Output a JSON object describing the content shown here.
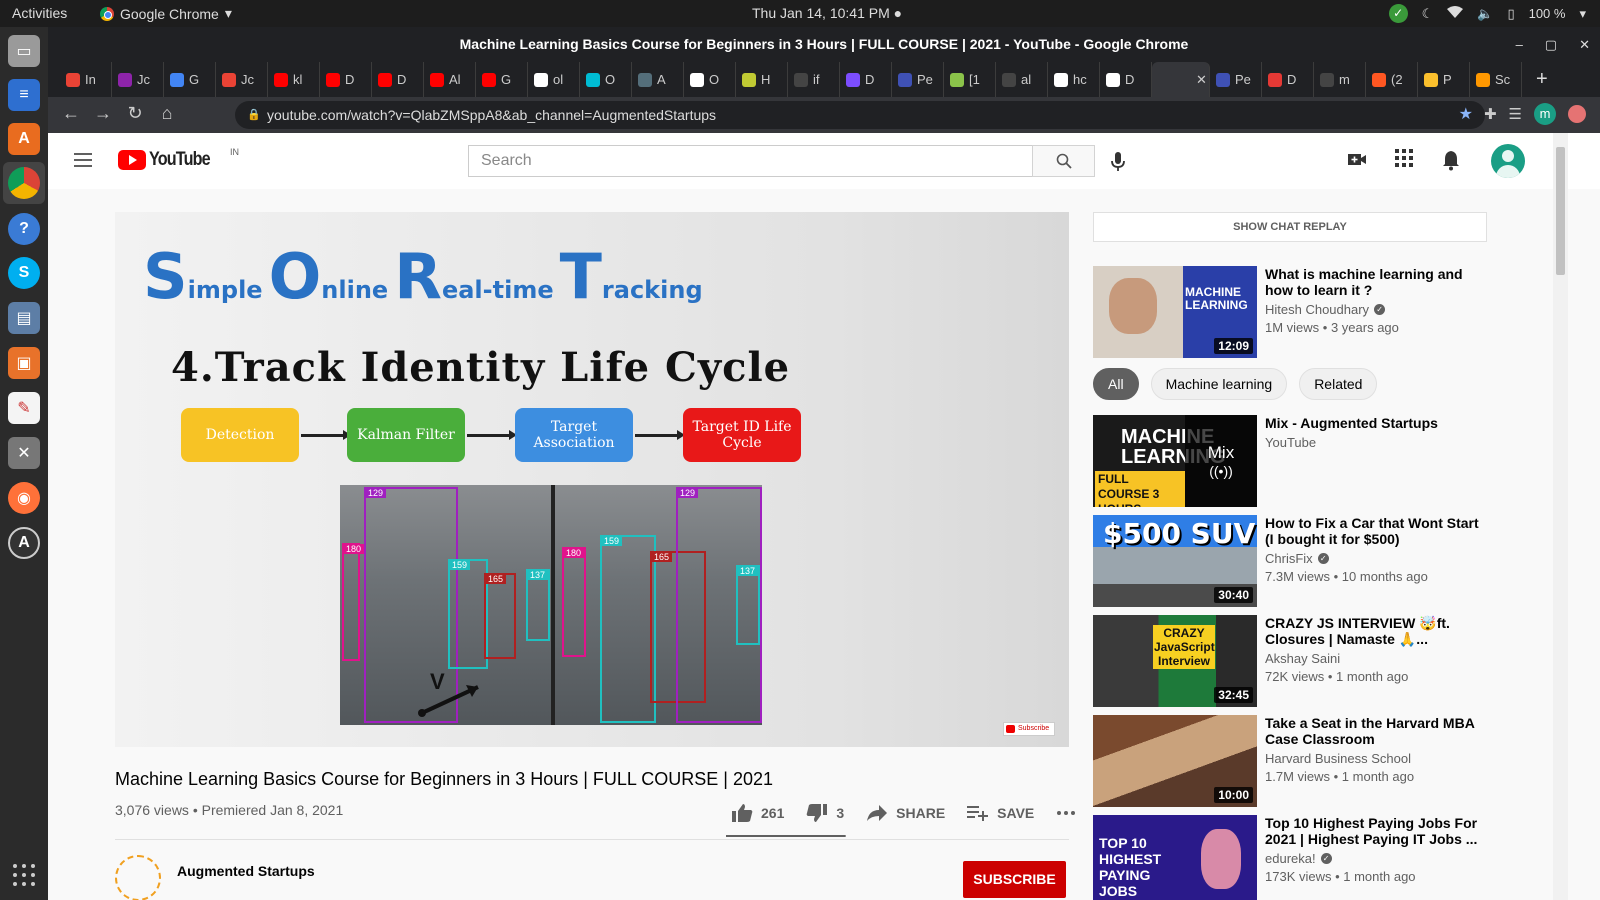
{
  "topbar": {
    "activities": "Activities",
    "app_name": "Google Chrome",
    "clock": "Thu Jan 14, 10:41 PM ●",
    "battery": "100 %"
  },
  "window": {
    "title": "Machine Learning Basics Course for Beginners in 3 Hours | FULL COURSE | 2021 - YouTube - Google Chrome"
  },
  "tabs": [
    {
      "label": "In",
      "color": "#ea4335"
    },
    {
      "label": "Jc",
      "color": "#8e24aa"
    },
    {
      "label": "G",
      "color": "#4285f4"
    },
    {
      "label": "Jc",
      "color": "#ea4335"
    },
    {
      "label": "kl",
      "color": "#ff0000"
    },
    {
      "label": "D",
      "color": "#ff0000"
    },
    {
      "label": "D",
      "color": "#ff0000"
    },
    {
      "label": "Al",
      "color": "#ff0000"
    },
    {
      "label": "G",
      "color": "#ff0000"
    },
    {
      "label": "ol",
      "color": "#ffffff"
    },
    {
      "label": "O",
      "color": "#00bcd4"
    },
    {
      "label": "A",
      "color": "#546e7a"
    },
    {
      "label": "O",
      "color": "#ffffff"
    },
    {
      "label": "H",
      "color": "#c0ca33"
    },
    {
      "label": "if",
      "color": "#444444"
    },
    {
      "label": "D",
      "color": "#7c4dff"
    },
    {
      "label": "Pe",
      "color": "#3f51b5"
    },
    {
      "label": "[1",
      "color": "#8bc34a"
    },
    {
      "label": "al",
      "color": "#444444"
    },
    {
      "label": "hc",
      "color": "#ffffff"
    },
    {
      "label": "D",
      "color": "#ffffff"
    },
    {
      "label": "",
      "color": "#35363a",
      "active": true,
      "close": "✕"
    },
    {
      "label": "Pe",
      "color": "#3f51b5"
    },
    {
      "label": "D",
      "color": "#e53935"
    },
    {
      "label": "m",
      "color": "#444444"
    },
    {
      "label": "(2",
      "color": "#ff5722"
    },
    {
      "label": "P",
      "color": "#fbc02d"
    },
    {
      "label": "Sc",
      "color": "#ff9800"
    }
  ],
  "address": {
    "url": "youtube.com/watch?v=QlabZMSppA8&ab_channel=AugmentedStartups",
    "profile_initial": "m"
  },
  "yt_header": {
    "logo_text": "YouTube",
    "country_code": "IN",
    "search_placeholder": "Search"
  },
  "player": {
    "sort_title": {
      "S": "S",
      "imple": "imple",
      "O": "O",
      "nline": "nline",
      "R": "R",
      "ealtime": "eal-time",
      "T": "T",
      "racking": "racking"
    },
    "slide_heading": "4.Track Identity Life Cycle",
    "flow": [
      "Detection",
      "Kalman Filter",
      "Target Association",
      "Target ID Life Cycle"
    ],
    "track_ids": {
      "a": "129",
      "b": "180",
      "c": "159",
      "d": "165",
      "e": "137"
    },
    "velocity_label": "V",
    "watermark": "Subscribe"
  },
  "video": {
    "title": "Machine Learning Basics Course for Beginners in 3 Hours | FULL COURSE | 2021",
    "meta": "3,076 views • Premiered Jan 8, 2021",
    "likes": "261",
    "dislikes": "3",
    "like_fraction": 0.989,
    "share_label": "SHARE",
    "save_label": "SAVE"
  },
  "channel": {
    "name": "Augmented Startups",
    "subscribe_label": "SUBSCRIBE"
  },
  "sidebar": {
    "chat_replay": "SHOW CHAT REPLAY",
    "chips": [
      "All",
      "Machine learning",
      "Related"
    ],
    "recs": [
      {
        "title": "What is machine learning and how to learn it ?",
        "channel": "Hitesh Choudhary",
        "verified": true,
        "stats": "1M views • 3 years ago",
        "duration": "12:09",
        "thumb_text": "MACHINE LEARNING"
      },
      {
        "title": "How to Fix a Car that Wont Start (I bought it for $500)",
        "channel": "ChrisFix",
        "verified": true,
        "stats": "7.3M views • 10 months ago",
        "duration": "30:40",
        "thumb_text": "$500 SUV"
      },
      {
        "title": "CRAZY JS INTERVIEW 🤯ft. Closures | Namaste 🙏...",
        "channel": "Akshay Saini",
        "verified": false,
        "stats": "72K views • 1 month ago",
        "duration": "32:45",
        "thumb_text": "CRAZY JavaScript Interview"
      },
      {
        "title": "Take a Seat in the Harvard MBA Case Classroom",
        "channel": "Harvard Business School",
        "verified": false,
        "stats": "1.7M views • 1 month ago",
        "duration": "10:00",
        "thumb_text": ""
      },
      {
        "title": "Top 10 Highest Paying Jobs For 2021 | Highest Paying IT Jobs ...",
        "channel": "edureka!",
        "verified": true,
        "stats": "173K views • 1 month ago",
        "duration": "",
        "thumb_text": "TOP 10 HIGHEST PAYING JOBS"
      }
    ],
    "mix": {
      "title": "Mix - Augmented Startups",
      "channel": "YouTube",
      "panel_label": "Mix",
      "thumb_text": "MACHINE LEARNING",
      "thumb_sub": "FULL COURSE 3 HOURS"
    }
  }
}
